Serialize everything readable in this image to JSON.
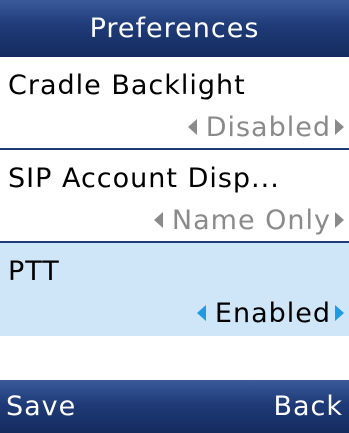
{
  "title": "Preferences",
  "settings": [
    {
      "label": "Cradle Backlight",
      "value": "Disabled"
    },
    {
      "label": "SIP Account Disp...",
      "value": "Name Only"
    },
    {
      "label": "PTT",
      "value": "Enabled"
    }
  ],
  "softkeys": {
    "left": "Save",
    "right": "Back"
  },
  "colors": {
    "header_bg": "#1f3b78",
    "selected_row_bg": "#cfe6f9",
    "active_arrow": "#1e9be3",
    "inactive_text": "#8a8a8a"
  },
  "icons": {
    "left_arrow": "triangle-left-icon",
    "right_arrow": "triangle-right-icon"
  }
}
